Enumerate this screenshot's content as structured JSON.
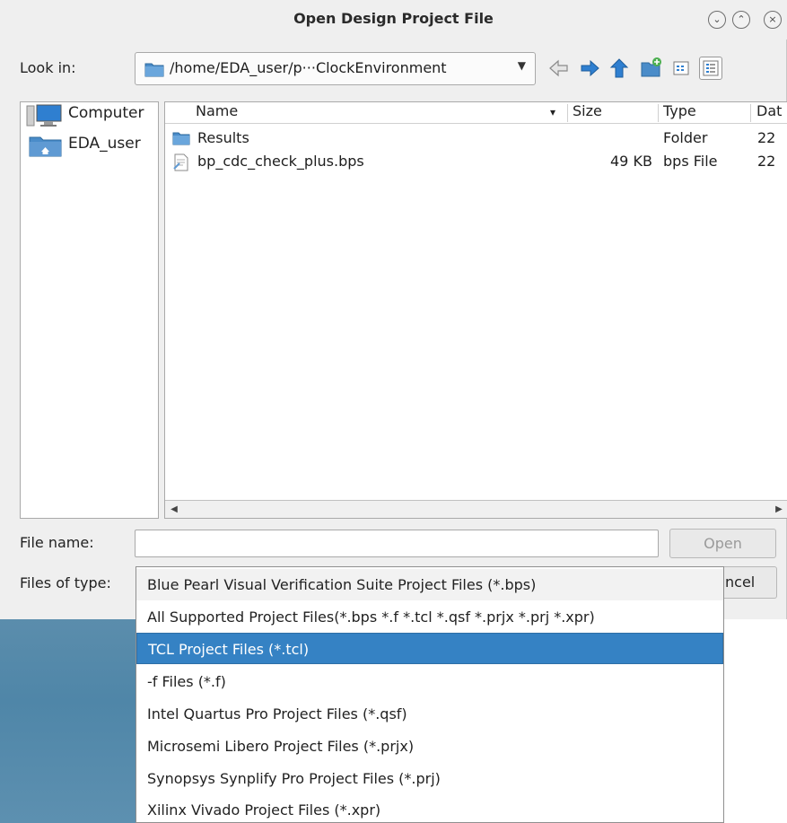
{
  "window": {
    "title": "Open Design Project File",
    "min_glyph": "⌄",
    "max_glyph": "⌃",
    "close_glyph": "×"
  },
  "look_in": {
    "label": "Look in:",
    "path": "/home/EDA_user/p···ClockEnvironment",
    "arrow": "▼"
  },
  "toolbar": {
    "icons": [
      "back-arrow-icon",
      "forward-arrow-icon",
      "up-arrow-icon",
      "new-folder-icon",
      "list-view-icon",
      "detail-view-icon"
    ]
  },
  "sidebar": {
    "items": [
      {
        "label": "Computer",
        "icon": "computer-icon"
      },
      {
        "label": "EDA_user",
        "icon": "home-folder-icon"
      }
    ]
  },
  "files": {
    "columns": [
      "Name",
      "Size",
      "Type",
      "Dat"
    ],
    "sort_glyph": "▾",
    "rows": [
      {
        "name": "Results",
        "size": "",
        "type": "Folder",
        "date": "22",
        "icon": "folder-icon"
      },
      {
        "name": "bp_cdc_check_plus.bps",
        "size": "49 KB",
        "type": "bps File",
        "date": "22",
        "icon": "document-icon"
      }
    ],
    "scroll_left": "◀",
    "scroll_right": "▶"
  },
  "file_name": {
    "label": "File name:",
    "value": "",
    "open_button": "Open"
  },
  "file_type": {
    "label": "Files of type:",
    "cancel_partial": "ncel",
    "options": [
      "Blue Pearl Visual Verification Suite Project Files (*.bps)",
      "All Supported Project Files(*.bps *.f *.tcl *.qsf *.prjx *.prj *.xpr)",
      "TCL Project Files (*.tcl)",
      "-f Files (*.f)",
      "Intel Quartus Pro Project Files (*.qsf)",
      "Microsemi Libero Project Files (*.prjx)",
      "Synopsys Synplify Pro Project Files (*.prj)",
      "Xilinx Vivado Project Files (*.xpr)"
    ],
    "selected_index": 2
  },
  "colors": {
    "selection": "#3582c4",
    "dialog_bg": "#efefef",
    "desktop": "#4f86a8"
  }
}
